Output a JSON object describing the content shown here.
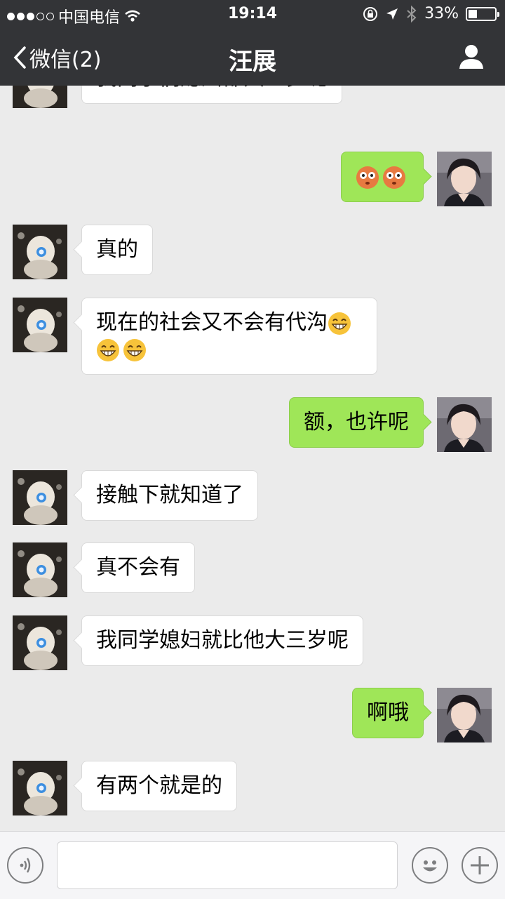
{
  "status_bar": {
    "carrier": "中国电信",
    "signal_dots_filled": 3,
    "signal_dots_total": 5,
    "time": "19:14",
    "battery_percent_label": "33%",
    "battery_level": 0.33
  },
  "nav": {
    "back_label": "微信(2)",
    "title": "汪展",
    "profile_icon": "person-icon"
  },
  "messages": [
    {
      "dir": "in",
      "text": "我同学们媳妇都大三岁呢"
    },
    {
      "dir": "out",
      "text": "",
      "emojis": [
        "flushed-face-emoji",
        "flushed-face-emoji"
      ]
    },
    {
      "dir": "in",
      "text": "真的"
    },
    {
      "dir": "in",
      "text": "现在的社会又不会有代沟",
      "emojis": [
        "grin-emoji",
        "grin-emoji",
        "grin-emoji"
      ]
    },
    {
      "dir": "out",
      "text": "额，也许呢"
    },
    {
      "dir": "in",
      "text": "接触下就知道了"
    },
    {
      "dir": "in",
      "text": "真不会有"
    },
    {
      "dir": "in",
      "text": "我同学媳妇就比他大三岁呢"
    },
    {
      "dir": "out",
      "text": "啊哦"
    },
    {
      "dir": "in",
      "text": "有两个就是的"
    }
  ],
  "input_bar": {
    "voice_icon": "voice-icon",
    "text_value": "",
    "emoji_icon": "smiley-icon",
    "plus_icon": "plus-icon"
  },
  "colors": {
    "nav_bg": "#333437",
    "chat_bg": "#ebebeb",
    "outgoing_bubble": "#9fe658",
    "incoming_bubble": "#ffffff"
  }
}
